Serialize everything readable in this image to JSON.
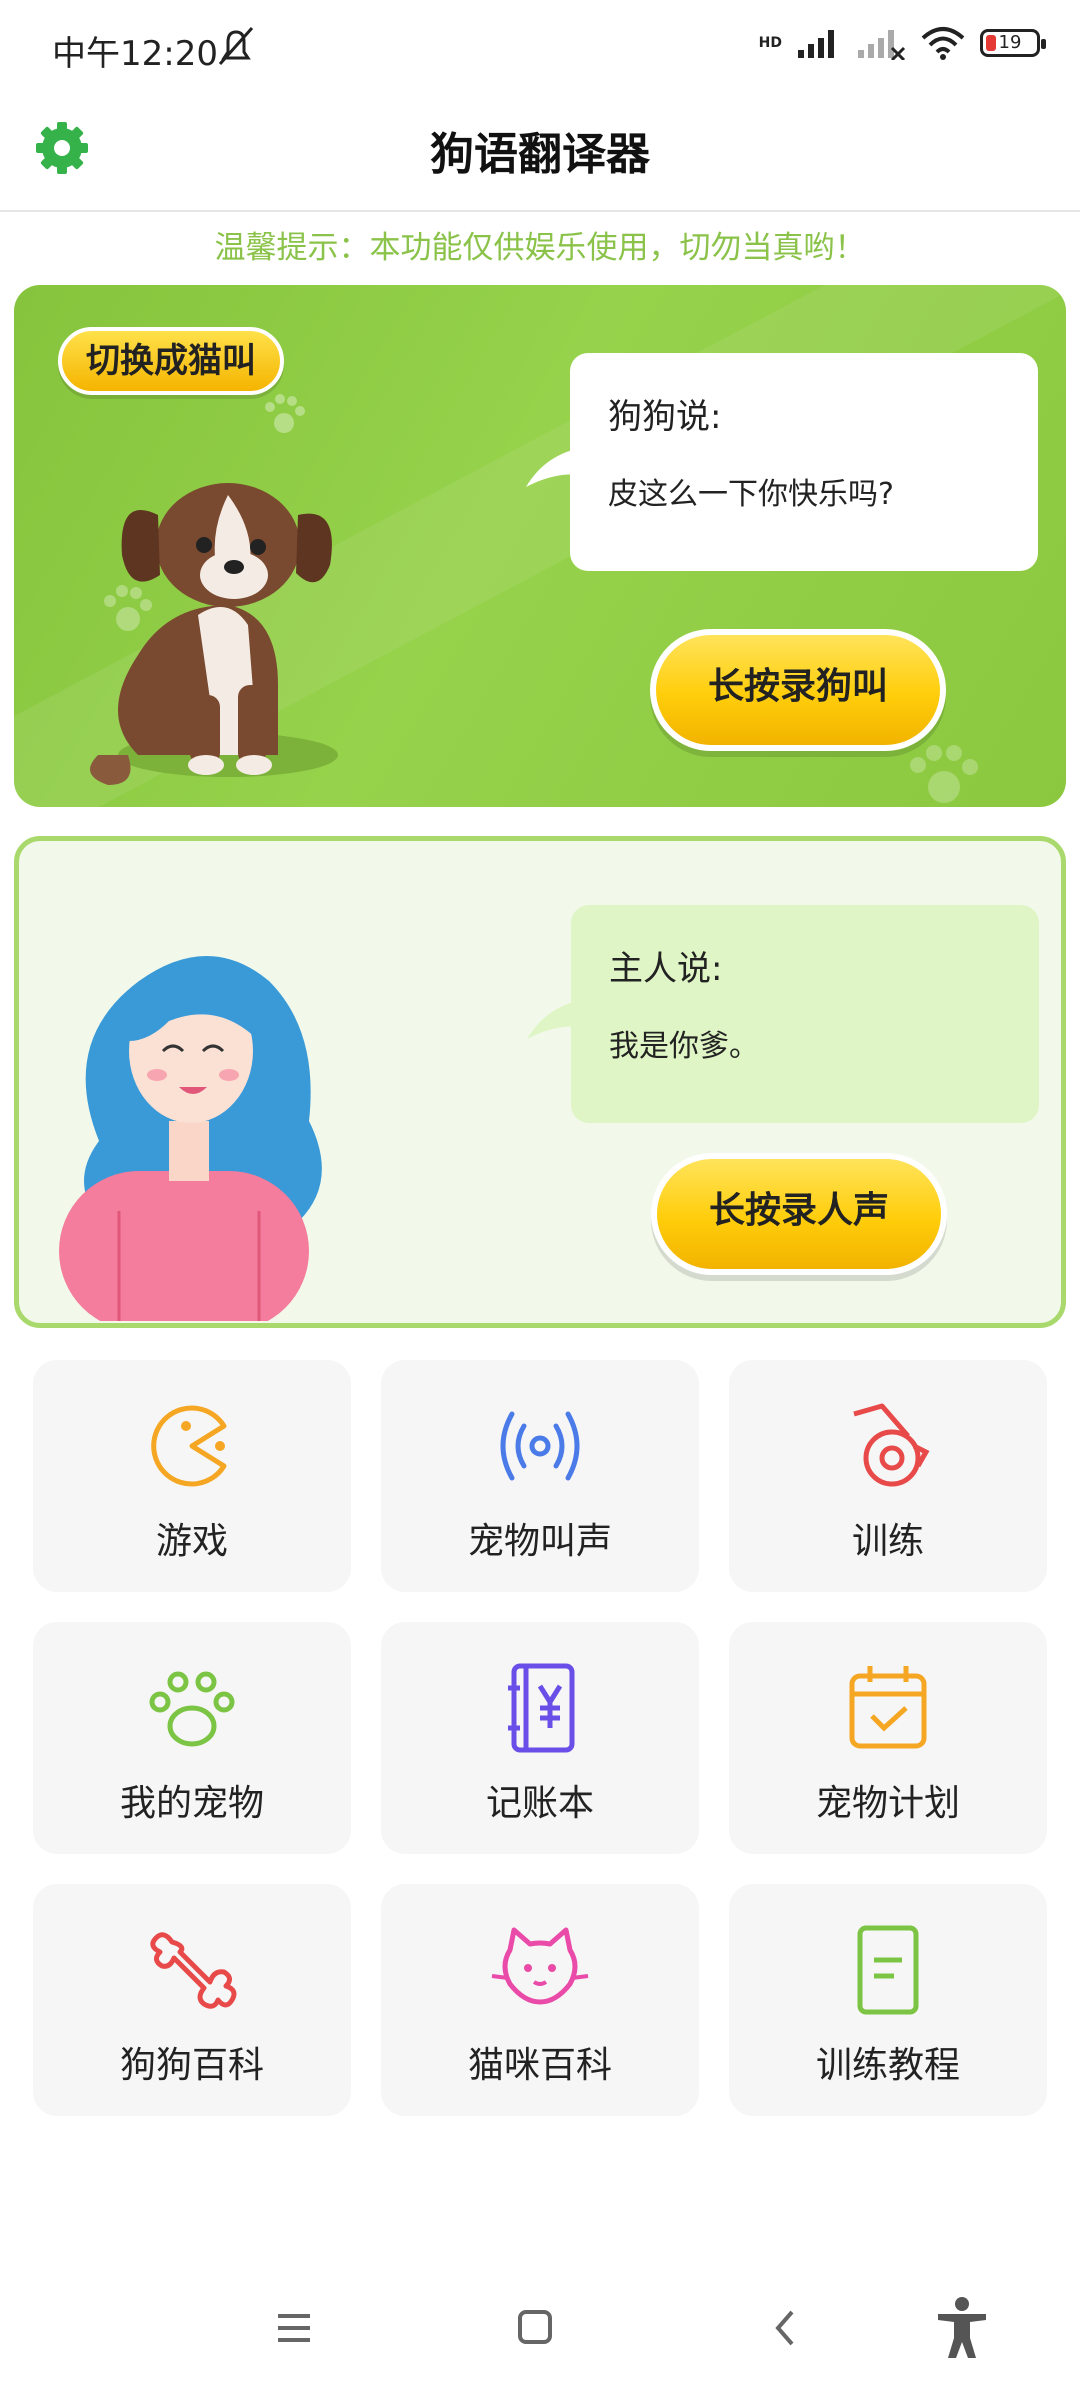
{
  "status": {
    "time": "中午12:20",
    "hd": "HD",
    "battery": "19"
  },
  "header": {
    "title": "狗语翻译器",
    "settings_icon": "gear-icon"
  },
  "tip": "温馨提示：本功能仅供娱乐使用，切勿当真哟！",
  "dog_card": {
    "switch_label": "切换成猫叫",
    "bubble_title": "狗狗说:",
    "bubble_text": "皮这么一下你快乐吗?",
    "record_label": "长按录狗叫"
  },
  "owner_card": {
    "bubble_title": "主人说:",
    "bubble_text": "我是你爹。",
    "record_label": "长按录人声"
  },
  "grid": [
    {
      "label": "游戏",
      "icon": "game-icon"
    },
    {
      "label": "宠物叫声",
      "icon": "sound-icon"
    },
    {
      "label": "训练",
      "icon": "whistle-icon"
    },
    {
      "label": "我的宠物",
      "icon": "paw-icon"
    },
    {
      "label": "记账本",
      "icon": "ledger-icon"
    },
    {
      "label": "宠物计划",
      "icon": "calendar-icon"
    },
    {
      "label": "狗狗百科",
      "icon": "bone-icon"
    },
    {
      "label": "猫咪百科",
      "icon": "cat-icon"
    },
    {
      "label": "训练教程",
      "icon": "book-icon"
    }
  ],
  "nav": [
    "menu-icon",
    "home-icon",
    "back-icon",
    "accessibility-icon"
  ]
}
